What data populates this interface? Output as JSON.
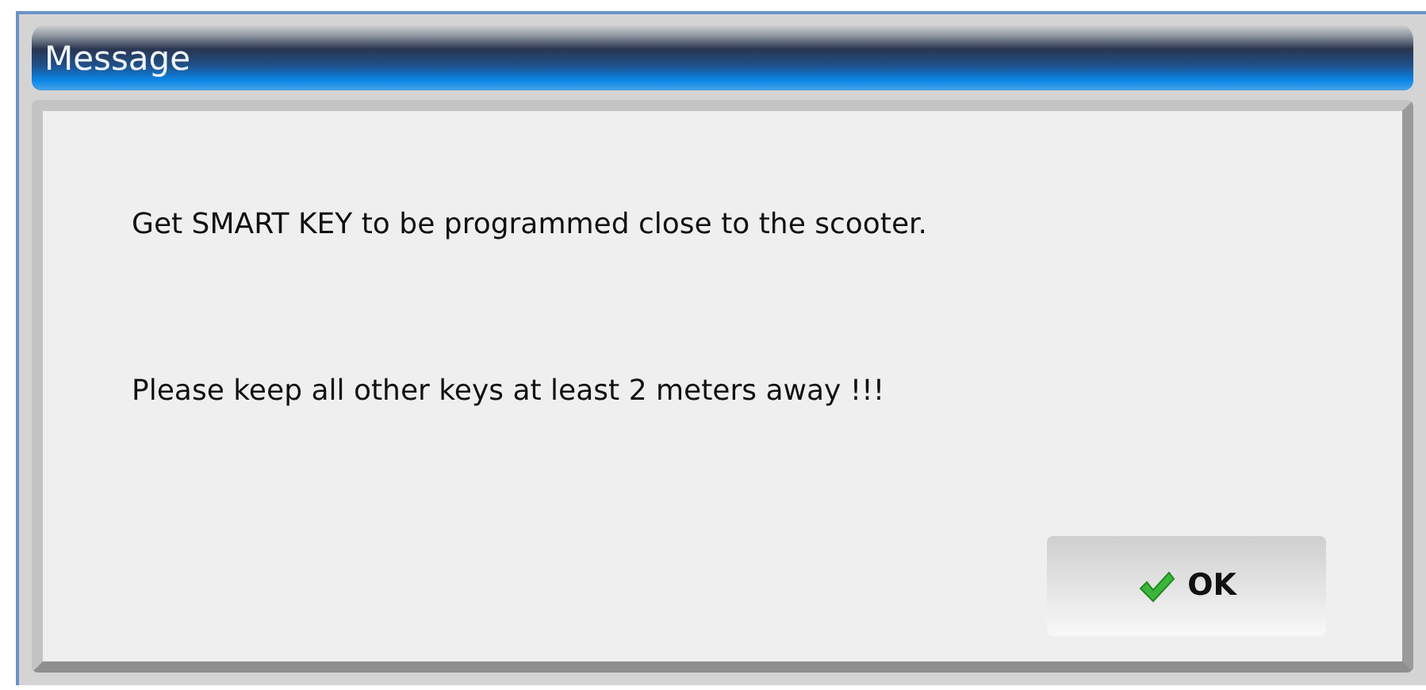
{
  "window": {
    "title": "Message"
  },
  "messages": [
    "Get SMART KEY to be programmed close to the scooter.",
    "Please keep all other keys at least 2 meters away !!!"
  ],
  "buttons": [
    {
      "label": "OK",
      "kind": "confirm"
    }
  ]
}
